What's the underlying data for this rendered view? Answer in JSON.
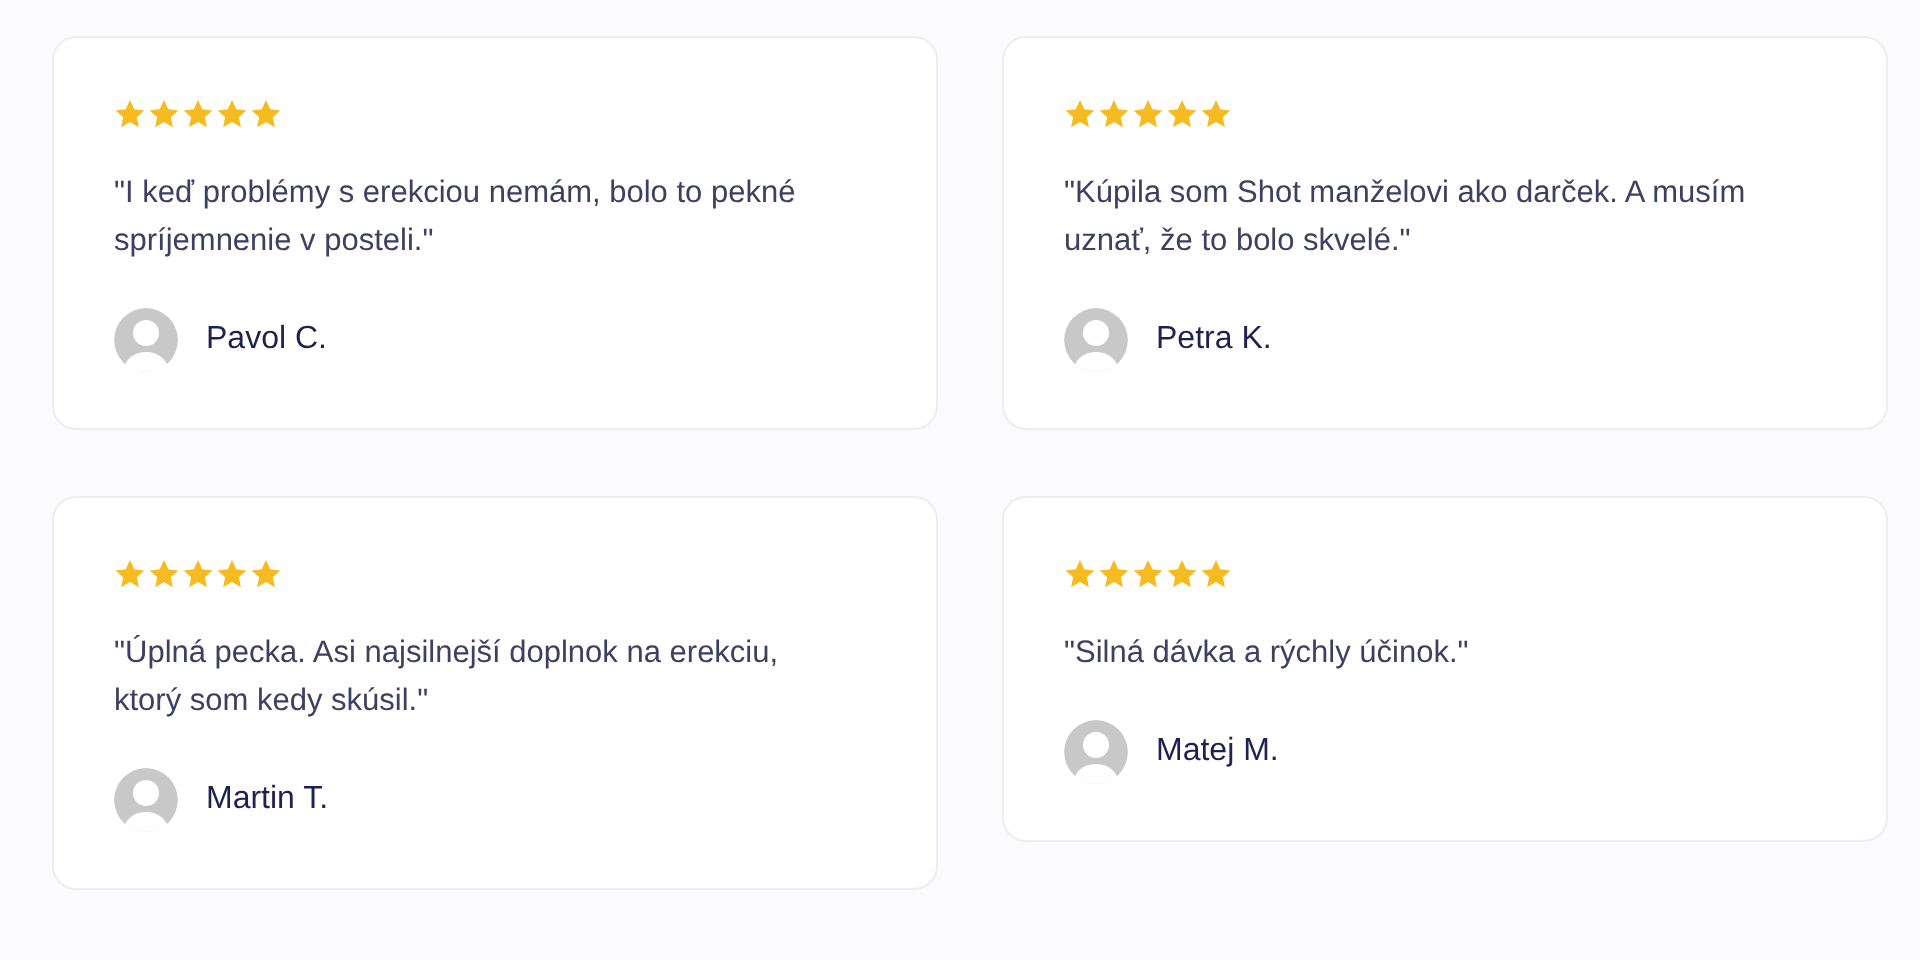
{
  "reviews": [
    {
      "stars": 5,
      "quote": "\"I keď problémy s erekciou nemám, bolo to pekné spríjemnenie v posteli.\"",
      "author": "Pavol C."
    },
    {
      "stars": 5,
      "quote": "\"Kúpila som Shot manželovi ako darček. A musím uznať, že to bolo skvelé.\"",
      "author": "Petra K."
    },
    {
      "stars": 5,
      "quote": "\"Úplná pecka. Asi najsilnejší doplnok na erekciu, ktorý som kedy skúsil.\"",
      "author": "Martin T."
    },
    {
      "stars": 5,
      "quote": "\"Silná dávka a rýchly účinok.\"",
      "author": "Matej M."
    }
  ]
}
